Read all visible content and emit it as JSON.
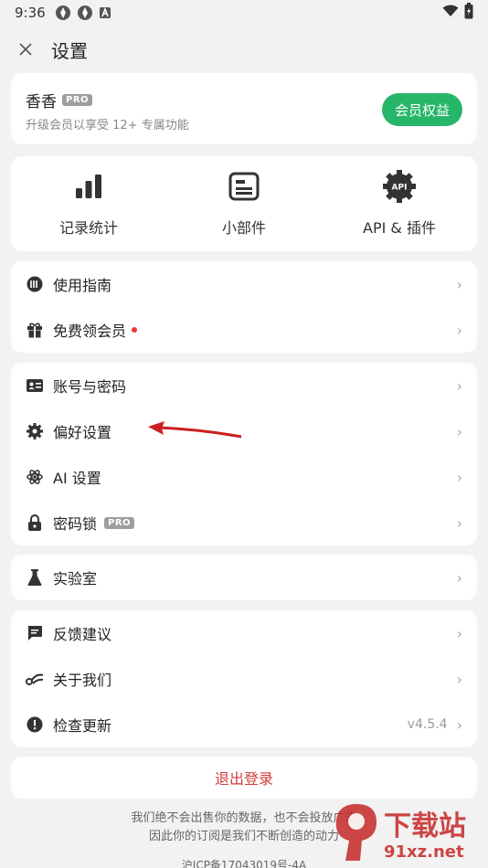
{
  "status_bar": {
    "time": "9:36"
  },
  "header": {
    "title": "设置"
  },
  "member": {
    "name": "香香",
    "badge": "PRO",
    "subtitle": "升级会员以享受 12+ 专属功能",
    "button": "会员权益"
  },
  "tools": [
    {
      "label": "记录统计",
      "icon": "bar-chart-icon"
    },
    {
      "label": "小部件",
      "icon": "widget-icon"
    },
    {
      "label": "API & 插件",
      "icon": "api-icon",
      "icon_text": "API"
    }
  ],
  "group1": [
    {
      "label": "使用指南",
      "icon": "guide-icon"
    },
    {
      "label": "免费领会员",
      "icon": "gift-icon",
      "dot": true
    }
  ],
  "group2": [
    {
      "label": "账号与密码",
      "icon": "id-card-icon"
    },
    {
      "label": "偏好设置",
      "icon": "gear-icon"
    },
    {
      "label": "AI 设置",
      "icon": "atom-icon"
    },
    {
      "label": "密码锁",
      "icon": "lock-icon",
      "badge": "PRO"
    }
  ],
  "group3": [
    {
      "label": "实验室",
      "icon": "flask-icon"
    }
  ],
  "group4": [
    {
      "label": "反馈建议",
      "icon": "feedback-icon"
    },
    {
      "label": "关于我们",
      "icon": "about-icon"
    },
    {
      "label": "检查更新",
      "icon": "alert-icon",
      "value": "v4.5.4"
    }
  ],
  "logout": "退出登录",
  "footer": {
    "line1": "我们绝不会出售你的数据，也不会投放广告",
    "line2": "因此你的订阅是我们不断创造的动力",
    "icp": "沪ICP备17043019号-4A"
  },
  "watermark": {
    "cn": "下载站",
    "domain": "91xz.net"
  },
  "colors": {
    "accent": "#27b56a",
    "danger": "#d23b3b",
    "background": "#f2f2f2"
  }
}
